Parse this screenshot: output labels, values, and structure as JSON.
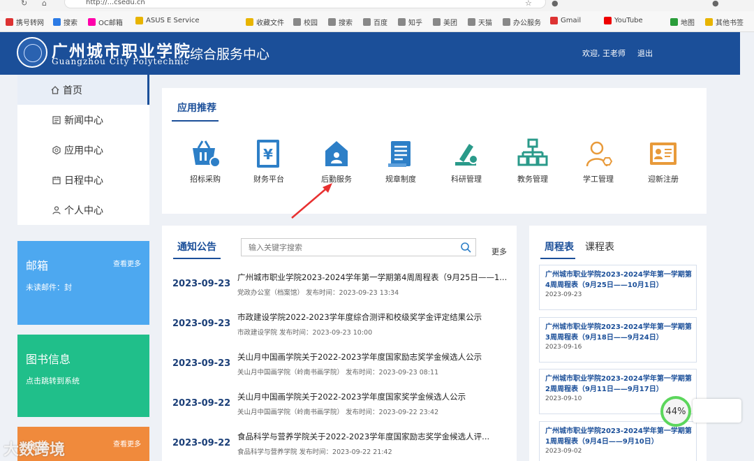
{
  "browser": {
    "url": "http://...csedu.cn",
    "bookmarks": [
      {
        "label": "携号转网",
        "color": "#d33"
      },
      {
        "label": "搜索",
        "color": "#2c7be5"
      },
      {
        "label": "OC邮箱",
        "color": "#f0a"
      },
      {
        "label": "ASUS E Service",
        "color": "#e8b400"
      },
      {
        "label": "收藏文件",
        "color": "#e8b400"
      },
      {
        "label": "校园",
        "color": "#888"
      },
      {
        "label": "搜索",
        "color": "#888"
      },
      {
        "label": "百度",
        "color": "#888"
      },
      {
        "label": "知乎",
        "color": "#888"
      },
      {
        "label": "美团",
        "color": "#888"
      },
      {
        "label": "天猫",
        "color": "#888"
      },
      {
        "label": "办公服务",
        "color": "#888"
      },
      {
        "label": "Gmail",
        "color": "#d33"
      },
      {
        "label": "YouTube",
        "color": "#e00"
      },
      {
        "label": "地图",
        "color": "#2a9d3a"
      },
      {
        "label": "其他书签",
        "color": "#e8b400"
      }
    ]
  },
  "header": {
    "school_cn": "广州城市职业学院",
    "school_en": "Guangzhou City Polytechnic",
    "portal_title": "综合服务中心",
    "welcome": "欢迎, 王老师",
    "logout": "退出"
  },
  "sidebar": {
    "items": [
      {
        "label": "首页",
        "icon": "home-icon"
      },
      {
        "label": "新闻中心",
        "icon": "news-icon"
      },
      {
        "label": "应用中心",
        "icon": "app-icon"
      },
      {
        "label": "日程中心",
        "icon": "calendar-icon"
      },
      {
        "label": "个人中心",
        "icon": "user-icon"
      }
    ]
  },
  "cards": {
    "mail": {
      "title": "邮箱",
      "more": "查看更多",
      "desc": "未读邮件：封",
      "color": "#4da8f0"
    },
    "library": {
      "title": "图书信息",
      "desc": "点击跳转到系统",
      "color": "#20bf8a"
    },
    "canteen": {
      "title": "食堂",
      "more": "查看更多",
      "color": "#f08a3c"
    }
  },
  "apps": {
    "title": "应用推荐",
    "items": [
      {
        "label": "招标采购",
        "icon": "purchase-icon"
      },
      {
        "label": "财务平台",
        "icon": "finance-icon"
      },
      {
        "label": "后勤服务",
        "icon": "logistics-icon"
      },
      {
        "label": "规章制度",
        "icon": "rules-icon"
      },
      {
        "label": "科研管理",
        "icon": "research-icon"
      },
      {
        "label": "教务管理",
        "icon": "academic-icon"
      },
      {
        "label": "学工管理",
        "icon": "student-icon"
      },
      {
        "label": "迎新注册",
        "icon": "registration-icon"
      }
    ]
  },
  "notice": {
    "tab": "通知公告",
    "search_placeholder": "输入关键字搜索",
    "more": "更多",
    "items": [
      {
        "date": "2023-09-23",
        "title": "广州城市职业学院2023-2024学年第一学期第4周周程表（9月25日——1...",
        "meta": "党政办公室（档案馆）  发布时间：2023-09-23 13:34"
      },
      {
        "date": "2023-09-23",
        "title": "市政建设学院2022-2023学年度综合测评和校级奖学金评定结果公示",
        "meta": "市政建设学院  发布时间：2023-09-23 10:00"
      },
      {
        "date": "2023-09-23",
        "title": "关山月中国画学院关于2022-2023学年度国家励志奖学金候选人公示",
        "meta": "关山月中国画学院（岭南书画学院）  发布时间：2023-09-23 08:11"
      },
      {
        "date": "2023-09-22",
        "title": "关山月中国画学院关于2022-2023学年度国家奖学金候选人公示",
        "meta": "关山月中国画学院（岭南书画学院）  发布时间：2023-09-22 23:42"
      },
      {
        "date": "2023-09-22",
        "title": "食品科学与营养学院关于2022-2023学年度国家励志奖学金候选人评...",
        "meta": "食品科学与营养学院  发布时间：2023-09-22 21:42"
      }
    ]
  },
  "schedule": {
    "tab_active": "周程表",
    "tab_other": "课程表",
    "items": [
      {
        "title": "广州城市职业学院2023-2024学年第一学期第4周周程表（9月25日——10月1日）",
        "date": "2023-09-23"
      },
      {
        "title": "广州城市职业学院2023-2024学年第一学期第3周周程表（9月18日——9月24日）",
        "date": "2023-09-16"
      },
      {
        "title": "广州城市职业学院2023-2024学年第一学期第2周周程表（9月11日——9月17日）",
        "date": "2023-09-10"
      },
      {
        "title": "广州城市职业学院2023-2024学年第一学期第1周周程表（9月4日——9月10日）",
        "date": "2023-09-02"
      }
    ]
  },
  "overlay": {
    "speed": "44%",
    "watermark": "大数跨境",
    "arrow_color": "#e83030"
  }
}
